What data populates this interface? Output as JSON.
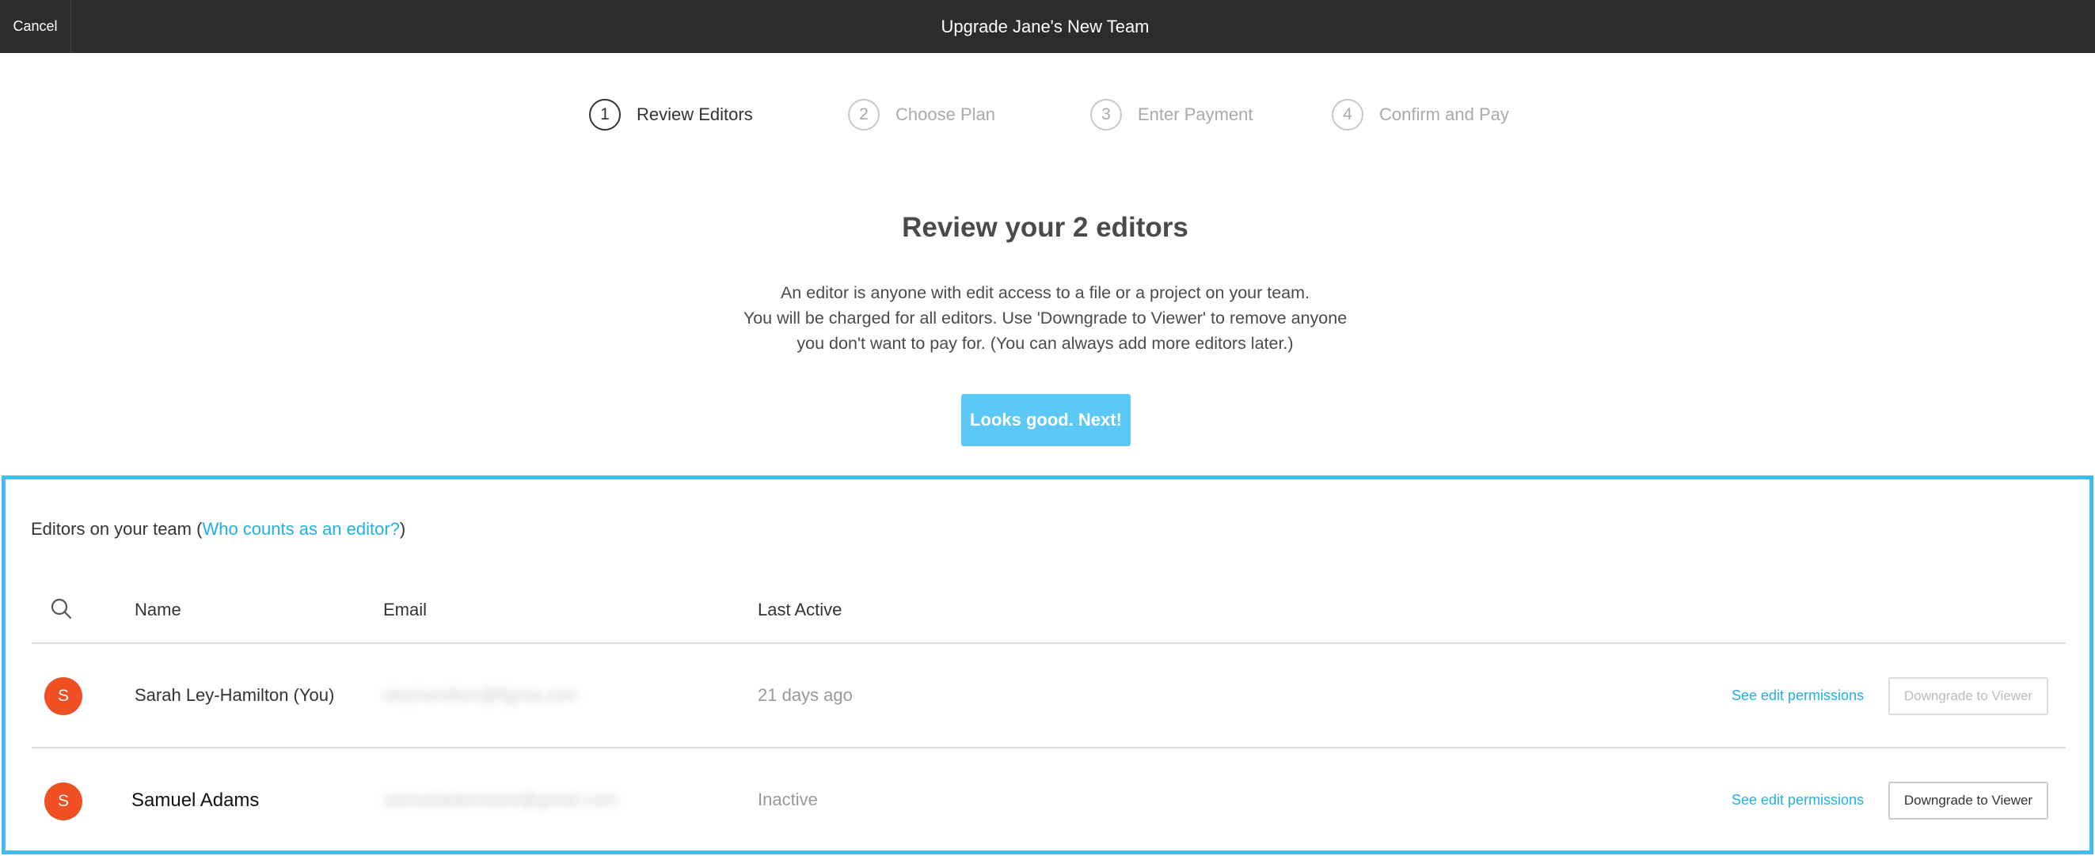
{
  "topbar": {
    "cancel_label": "Cancel",
    "title": "Upgrade Jane's New Team"
  },
  "steps": [
    {
      "number": "1",
      "label": "Review Editors",
      "active": true
    },
    {
      "number": "2",
      "label": "Choose Plan",
      "active": false
    },
    {
      "number": "3",
      "label": "Enter Payment",
      "active": false
    },
    {
      "number": "4",
      "label": "Confirm and Pay",
      "active": false
    }
  ],
  "main": {
    "heading": "Review your 2 editors",
    "description_lines": [
      "An editor is anyone with edit access to a file or a project on your team.",
      "You will be charged for all editors. Use 'Downgrade to Viewer' to remove anyone",
      "you don't want to pay for. (You can always add more editors later.)"
    ],
    "next_button": "Looks good. Next!"
  },
  "editors_panel": {
    "title_prefix": "Editors on your team (",
    "title_link": "Who counts as an editor?",
    "title_suffix": ")",
    "columns": {
      "name": "Name",
      "email": "Email",
      "last_active": "Last Active"
    },
    "rows": [
      {
        "avatar_initial": "S",
        "name": "Sarah Ley-Hamilton (You)",
        "email": "sleyhamilton@figma.com",
        "last_active": "21 days ago",
        "permissions_link": "See edit permissions",
        "downgrade_label": "Downgrade to Viewer",
        "downgrade_enabled": false
      },
      {
        "avatar_initial": "S",
        "name": "Samuel Adams",
        "email": "samueladamstest@gmail.com",
        "last_active": "Inactive",
        "permissions_link": "See edit permissions",
        "downgrade_label": "Downgrade to Viewer",
        "downgrade_enabled": true
      }
    ]
  },
  "colors": {
    "topbar_bg": "#2c2c2c",
    "accent": "#5bc8f5",
    "link": "#1fb0ea",
    "panel_border": "#3fbdf0",
    "avatar": "#f04e23"
  },
  "icons": {
    "search": "search-icon"
  }
}
